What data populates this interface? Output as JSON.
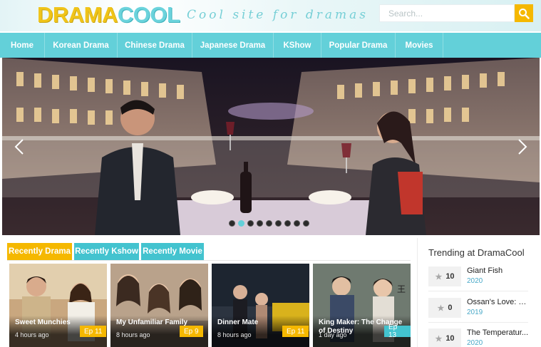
{
  "header": {
    "logo_part1": "DRAMA",
    "logo_part2": "COOL",
    "tagline": "Cool site for dramas",
    "search_placeholder": "Search...",
    "search_icon": "search-icon"
  },
  "nav": {
    "items": [
      {
        "label": "Home"
      },
      {
        "label": "Korean Drama"
      },
      {
        "label": "Chinese Drama"
      },
      {
        "label": "Japanese Drama"
      },
      {
        "label": "KShow"
      },
      {
        "label": "Popular Drama"
      },
      {
        "label": "Movies"
      }
    ]
  },
  "slider": {
    "prev_icon": "chevron-left-icon",
    "next_icon": "chevron-right-icon",
    "dot_count": 9,
    "active_dot": 1
  },
  "tabs": [
    {
      "label": "Recently Drama",
      "active": true
    },
    {
      "label": "Recently Kshow",
      "active": false
    },
    {
      "label": "Recently Movie",
      "active": false
    }
  ],
  "cards": [
    {
      "title": "Sweet Munchies",
      "time": "4 hours ago",
      "ep": "Ep 11",
      "ep_color": "#f5b800"
    },
    {
      "title": "My Unfamiliar Family",
      "time": "8 hours ago",
      "ep": "Ep 9",
      "ep_color": "#f5b800"
    },
    {
      "title": "Dinner Mate",
      "time": "8 hours ago",
      "ep": "Ep 11",
      "ep_color": "#f5b800"
    },
    {
      "title": "King Maker: The Change of Destiny",
      "time": "1 day ago",
      "ep": "Ep 13",
      "ep_color": "#43c3cf"
    }
  ],
  "trending": {
    "title": "Trending at DramaCool",
    "items": [
      {
        "rank": "10",
        "name": "Giant Fish",
        "year": "2020"
      },
      {
        "rank": "0",
        "name": "Ossan's Love: L...",
        "year": "2019"
      },
      {
        "rank": "10",
        "name": "The Temperatur...",
        "year": "2020"
      }
    ]
  },
  "colors": {
    "accent_teal": "#63d0d9",
    "accent_yellow": "#f5b800",
    "year_blue": "#4aa9c8"
  }
}
